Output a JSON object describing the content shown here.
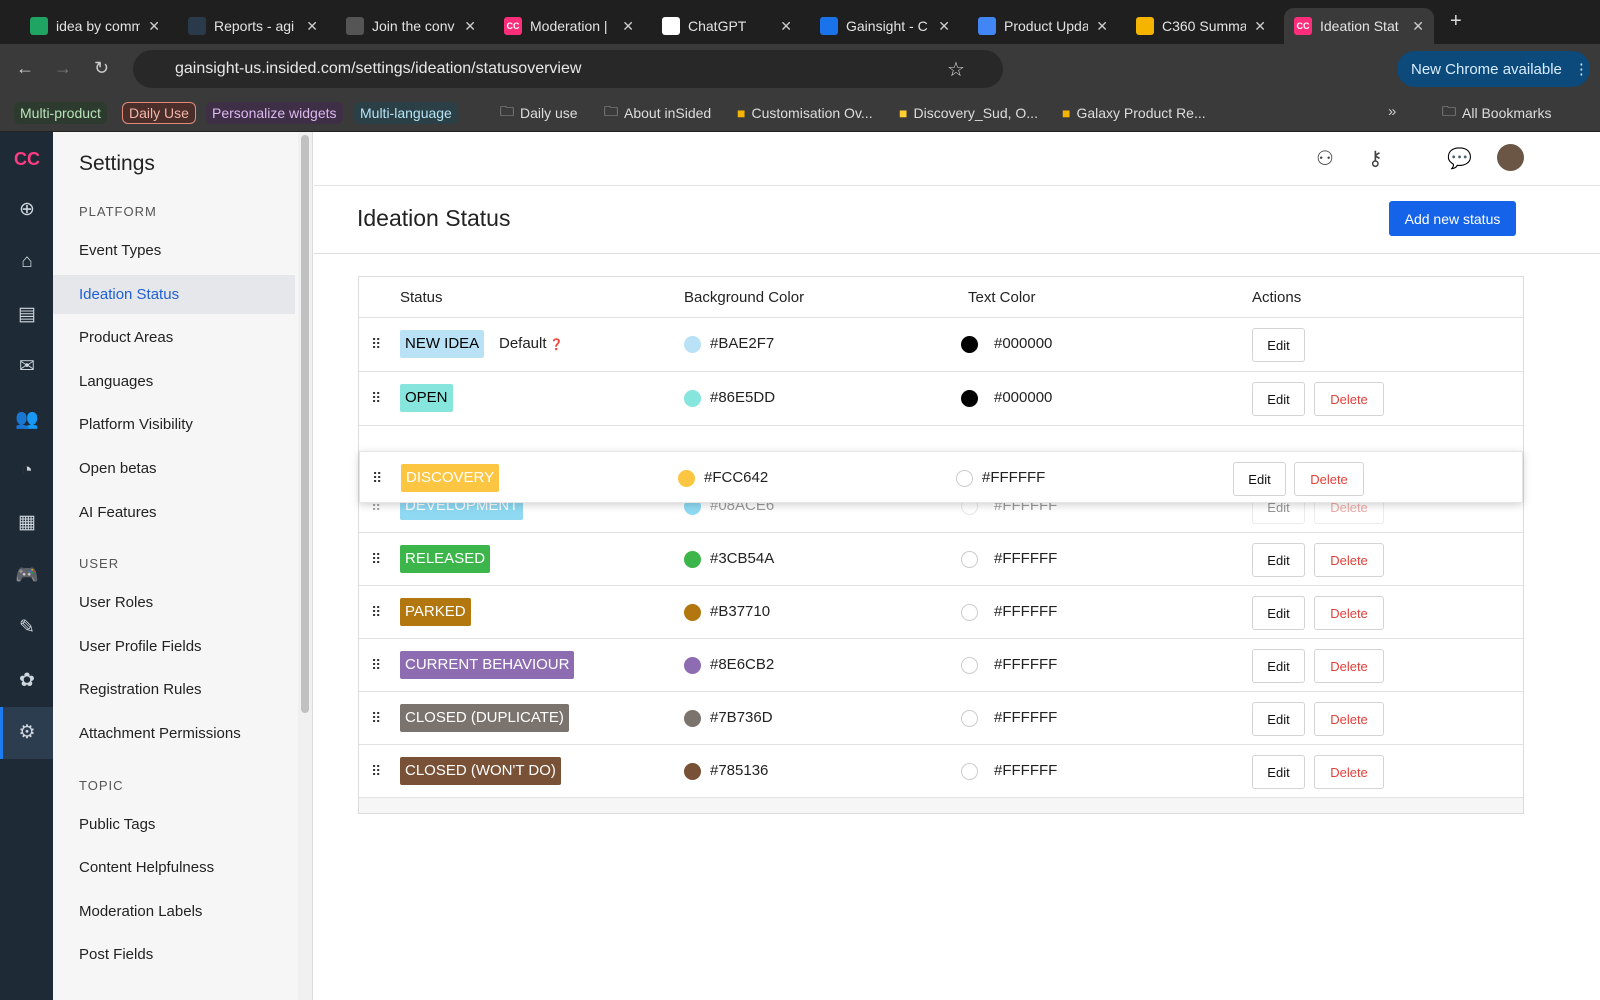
{
  "browser": {
    "tabs": [
      {
        "title": "idea by comm",
        "icon": "sheets-icon",
        "color": "#1fa463"
      },
      {
        "title": "Reports - agi",
        "icon": "g-icon",
        "color": "#2b3a4a"
      },
      {
        "title": "Join the conv",
        "icon": "loading-icon",
        "color": "#555"
      },
      {
        "title": "Moderation |",
        "icon": "cc-icon",
        "color": "#ff2d7a"
      },
      {
        "title": "ChatGPT",
        "icon": "chatgpt-icon",
        "color": "#fff"
      },
      {
        "title": "Gainsight - C",
        "icon": "calendar-icon",
        "color": "#1a73e8"
      },
      {
        "title": "Product Upda",
        "icon": "docs-icon",
        "color": "#4285f4"
      },
      {
        "title": "C360 Summa",
        "icon": "g-icon",
        "color": "#f5b400"
      },
      {
        "title": "Ideation Stat",
        "icon": "cc-icon",
        "color": "#ff2d7a"
      }
    ],
    "url": "gainsight-us.insided.com/settings/ideation/statusoverview",
    "new_chrome": "New Chrome available",
    "bookmarks": [
      {
        "label": "Multi-product",
        "bg": "#2d3b2f",
        "fg": "#b9e2b9"
      },
      {
        "label": "Daily Use",
        "bg": "#4a2e2a",
        "fg": "#f4b4aa",
        "border": "#e08a7c"
      },
      {
        "label": "Personalize widgets",
        "bg": "#3e2f47",
        "fg": "#dcb8ef"
      },
      {
        "label": "Multi-language",
        "bg": "#2b3f47",
        "fg": "#b6e3f2"
      },
      {
        "label": "Daily use",
        "icon": "folder-icon"
      },
      {
        "label": "About inSided",
        "icon": "folder-icon"
      },
      {
        "label": "Customisation Ov...",
        "icon": "slides-icon"
      },
      {
        "label": "Discovery_Sud, O...",
        "icon": "miro-icon"
      },
      {
        "label": "Galaxy Product Re...",
        "icon": "slides-icon"
      }
    ],
    "all_bookmarks": "All Bookmarks"
  },
  "sidebar": {
    "title": "Settings",
    "sections": [
      {
        "heading": "PLATFORM",
        "items": [
          "Event Types",
          "Ideation Status",
          "Product Areas",
          "Languages",
          "Platform Visibility",
          "Open betas",
          "AI Features"
        ]
      },
      {
        "heading": "USER",
        "items": [
          "User Roles",
          "User Profile Fields",
          "Registration Rules",
          "Attachment Permissions"
        ]
      },
      {
        "heading": "TOPIC",
        "items": [
          "Public Tags",
          "Content Helpfulness",
          "Moderation Labels",
          "Post Fields"
        ]
      }
    ],
    "active": "Ideation Status"
  },
  "page": {
    "title": "Ideation Status",
    "add_button": "Add new status",
    "columns": [
      "Status",
      "Background Color",
      "Text Color",
      "Actions"
    ],
    "default_label": "Default",
    "edit": "Edit",
    "delete": "Delete",
    "rows": [
      {
        "name": "NEW IDEA",
        "bg": "#BAE2F7",
        "text": "#000000",
        "default": true
      },
      {
        "name": "OPEN",
        "bg": "#86E5DD",
        "text": "#000000"
      },
      {
        "name": "DEVELOPMENT",
        "bg": "#08ACE6",
        "text": "#FFFFFF",
        "ghost": true
      },
      {
        "name": "RELEASED",
        "bg": "#3CB54A",
        "text": "#FFFFFF"
      },
      {
        "name": "PARKED",
        "bg": "#B37710",
        "text": "#FFFFFF"
      },
      {
        "name": "CURRENT BEHAVIOUR",
        "bg": "#8E6CB2",
        "text": "#FFFFFF"
      },
      {
        "name": "CLOSED (DUPLICATE)",
        "bg": "#7B736D",
        "text": "#FFFFFF"
      },
      {
        "name": "CLOSED (WON'T DO)",
        "bg": "#785136",
        "text": "#FFFFFF"
      }
    ],
    "dragging": {
      "name": "DISCOVERY",
      "bg": "#FCC642",
      "text": "#FFFFFF"
    }
  }
}
